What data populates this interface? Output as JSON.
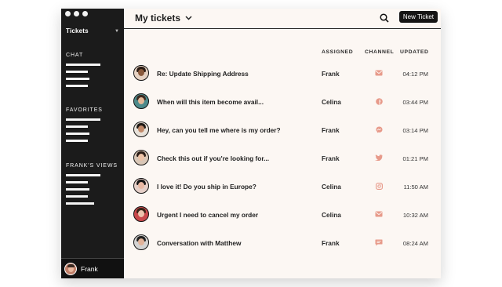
{
  "sidebar": {
    "tickets_label": "Tickets",
    "sections": [
      {
        "label": "CHAT",
        "bars": [
          44,
          28,
          30,
          28
        ]
      },
      {
        "label": "FAVORITES",
        "bars": [
          44,
          28,
          30,
          28
        ]
      },
      {
        "label": "FRANK'S VIEWS",
        "bars": [
          44,
          28,
          30,
          28,
          36
        ]
      }
    ],
    "user": "Frank"
  },
  "header": {
    "title": "My tickets",
    "new_ticket": "New Ticket"
  },
  "columns": {
    "assigned": "ASSIGNED",
    "channel": "CHANNEL",
    "updated": "UPDATED"
  },
  "tickets": [
    {
      "subject": "Re: Update Shipping Address",
      "assigned": "Frank",
      "channel": "email-icon",
      "time": "04:12 PM"
    },
    {
      "subject": "When will this item become avail...",
      "assigned": "Celina",
      "channel": "facebook-icon",
      "time": "03:44 PM"
    },
    {
      "subject": "Hey, can you tell me where is my order?",
      "assigned": "Frank",
      "channel": "messenger-icon",
      "time": "03:14 PM"
    },
    {
      "subject": "Check this out if you're looking for...",
      "assigned": "Frank",
      "channel": "twitter-icon",
      "time": "01:21 PM"
    },
    {
      "subject": "I love it! Do you ship in Europe?",
      "assigned": "Celina",
      "channel": "instagram-icon",
      "time": "11:50 AM"
    },
    {
      "subject": "Urgent I need to cancel my order",
      "assigned": "Celina",
      "channel": "email-icon",
      "time": "10:32 AM"
    },
    {
      "subject": "Conversation with Matthew",
      "assigned": "Frank",
      "channel": "chat-icon",
      "time": "08:24 AM"
    }
  ],
  "colors": {
    "accent": "#e79a8a",
    "sidebar": "#1b1b1b",
    "content": "#fcf7f3"
  }
}
